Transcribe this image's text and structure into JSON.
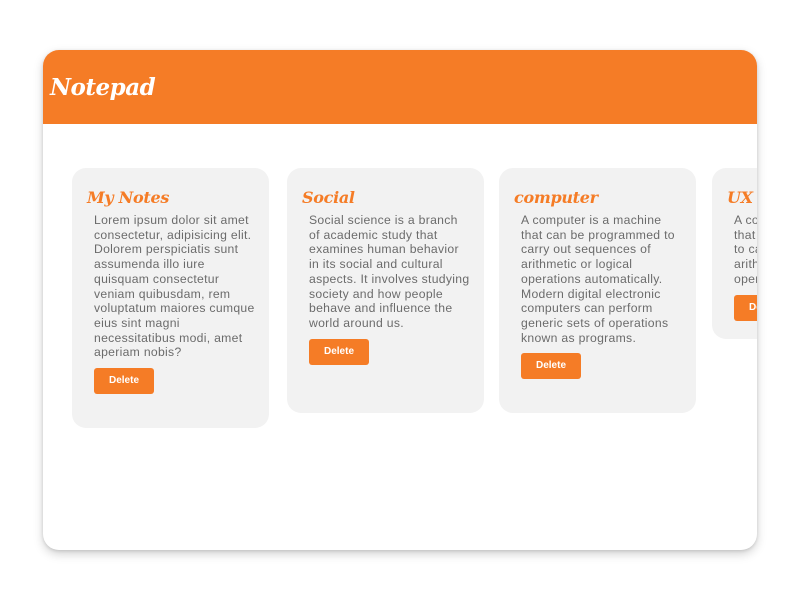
{
  "app": {
    "title": "Notepad"
  },
  "notes": [
    {
      "title": "My Notes",
      "body": "Lorem ipsum dolor sit amet consectetur, adipisicing elit. Dolorem perspiciatis sunt assumenda illo iure quisquam consectetur veniam quibusdam, rem voluptatum maiores cumque eius sint magni necessitatibus modi, amet aperiam nobis?",
      "delete_label": "Delete"
    },
    {
      "title": "Social",
      "body": "Social science is a branch of academic study that examines human behavior in its social and cultural aspects. It involves studying society and how people behave and influence the world around us.",
      "delete_label": "Delete"
    },
    {
      "title": "computer",
      "body": "A computer is a machine that can be programmed to carry out sequences of arithmetic or logical operations automatically. Modern digital electronic computers can perform generic sets of operations known as programs.",
      "delete_label": "Delete"
    },
    {
      "title": "UX",
      "body": "A computer is a machine that can be programmed to carry out sequences of arithmetic or logical operations",
      "delete_label": "Delete"
    }
  ],
  "colors": {
    "accent": "#f57c26",
    "card_background": "#f2f2f2",
    "body_text": "#6b6b6b"
  }
}
